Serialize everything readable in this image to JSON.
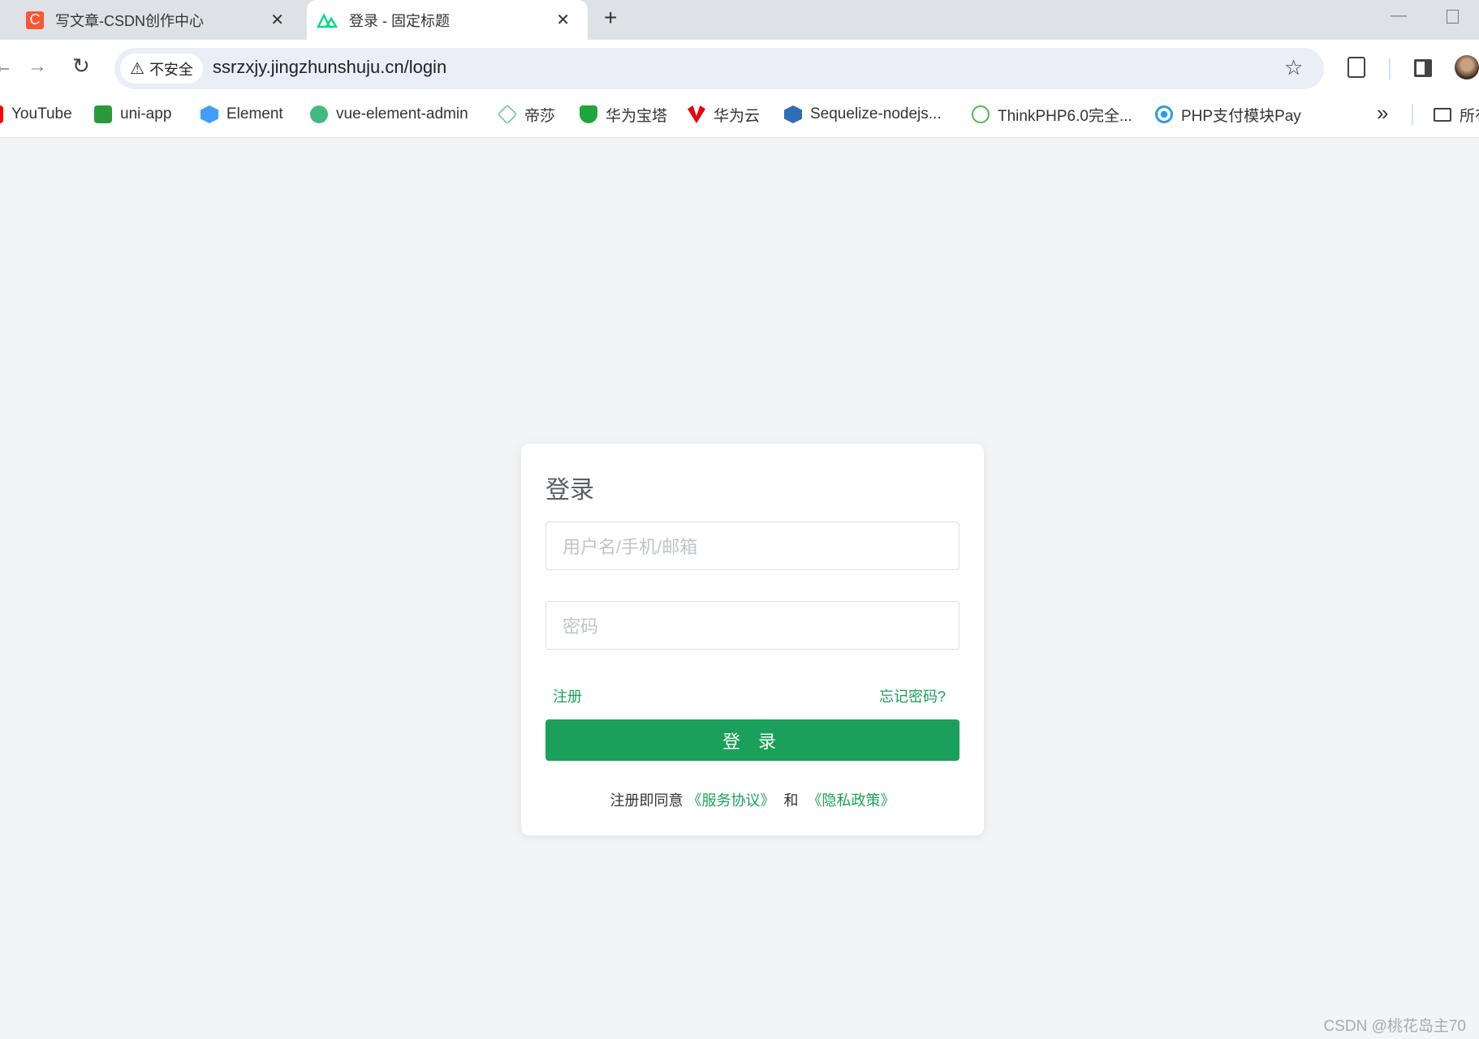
{
  "browser": {
    "tabs": [
      {
        "title": "写文章-CSDN创作中心",
        "icon": "csdn-icon",
        "active": false
      },
      {
        "title": "登录 - 固定标题",
        "icon": "nuxt-icon",
        "active": true
      }
    ],
    "security_label": "不安全",
    "url": "ssrzxjy.jingzhunshuju.cn/login",
    "bookmarks": [
      {
        "label": "YouTube",
        "icon": "youtube-icon"
      },
      {
        "label": "uni-app",
        "icon": "uniapp-icon"
      },
      {
        "label": "Element",
        "icon": "element-icon"
      },
      {
        "label": "vue-element-admin",
        "icon": "vue-icon"
      },
      {
        "label": "帝莎",
        "icon": "disha-icon"
      },
      {
        "label": "华为宝塔",
        "icon": "baota-icon"
      },
      {
        "label": "华为云",
        "icon": "huawei-icon"
      },
      {
        "label": "Sequelize-nodejs...",
        "icon": "sequelize-icon"
      },
      {
        "label": "ThinkPHP6.0完全...",
        "icon": "thinkphp-icon"
      },
      {
        "label": "PHP支付模块Pay",
        "icon": "pay-icon"
      }
    ],
    "more_bookmarks": "»",
    "all_bookmarks": "所有"
  },
  "login": {
    "title": "登录",
    "username_placeholder": "用户名/手机/邮箱",
    "password_placeholder": "密码",
    "register": "注册",
    "forgot": "忘记密码?",
    "submit": "登 录",
    "agree_prefix": "注册即同意",
    "service": "《服务协议》",
    "and": "和",
    "privacy": "《隐私政策》"
  },
  "watermark": "CSDN @桃花岛主70",
  "colors": {
    "accent": "#1aa05a"
  }
}
